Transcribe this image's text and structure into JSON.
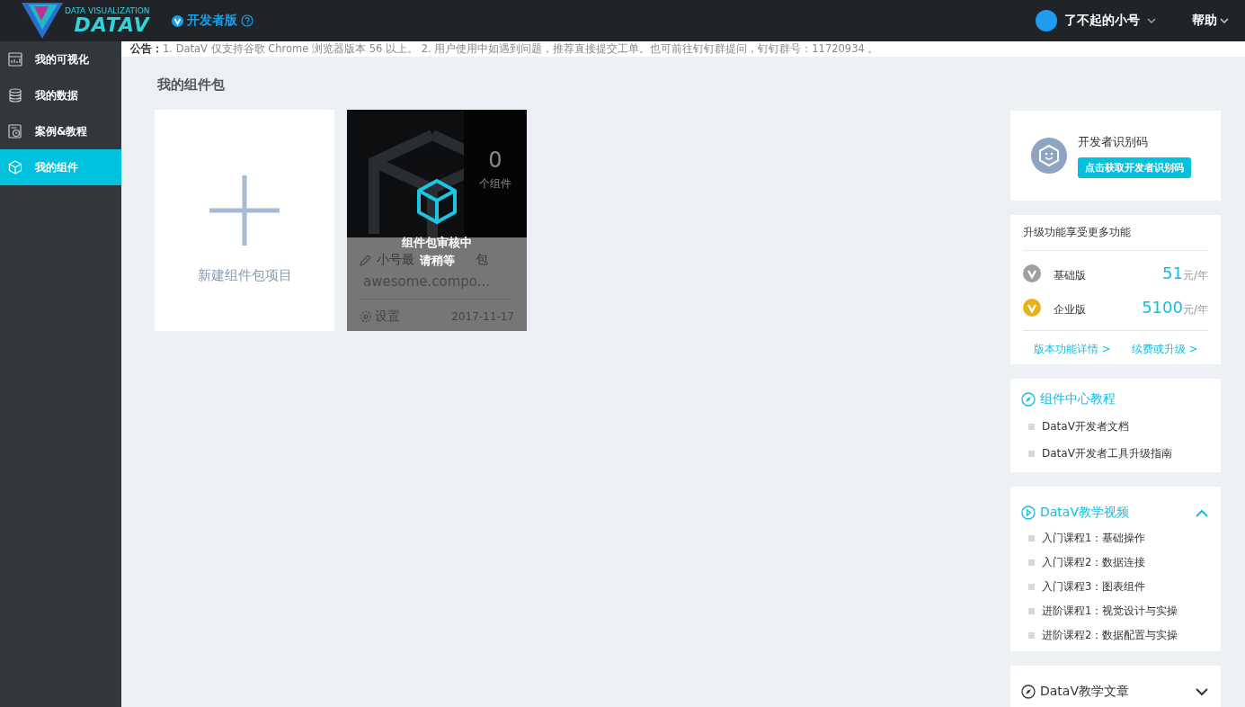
{
  "header": {
    "logo_caption": "DATA VISUALIZATION",
    "logo_text": "DATAV",
    "edition": "开发者版",
    "user": "了不起的小号",
    "help": "帮助"
  },
  "sidebar": {
    "items": [
      {
        "label": "我的可视化",
        "selected": false
      },
      {
        "label": "我的数据",
        "selected": false
      },
      {
        "label": "案例&教程",
        "selected": false
      },
      {
        "label": "我的组件",
        "selected": true
      }
    ]
  },
  "notice": {
    "label": "公告：",
    "text": "1. DataV 仅支持谷歌 Chrome 浏览器版本 56 以上。 2. 用户使用中如遇到问题，推荐直接提交工单。也可前往钉钉群提问，钉钉群号：11720934 。"
  },
  "page_title": "我的组件包",
  "new_card": {
    "label": "新建组件包项目"
  },
  "packages": [
    {
      "count": "0",
      "count_label": "个组件",
      "title_start": "小号最",
      "title_end": "包",
      "package_name": "awesome.compo...",
      "settings": "设置",
      "date": "2017-11-17",
      "reviewing": true,
      "review_line1": "组件包审核中",
      "review_line2": "请稍等"
    }
  ],
  "developer_code": {
    "title": "开发者识别码",
    "button": "点击获取开发者识别码"
  },
  "upgrade": {
    "title": "升级功能享受更多功能",
    "plans": [
      {
        "name": "基础版",
        "price": "51",
        "unit": "元/年",
        "color": "#a0a0a0"
      },
      {
        "name": "企业版",
        "price": "5100",
        "unit": "元/年",
        "color": "#e6b220"
      }
    ],
    "links": [
      "版本功能详情 >",
      "续费或升级 >"
    ]
  },
  "tutorials": {
    "title": "组件中心教程",
    "items": [
      "DataV开发者文档",
      "DataV开发者工具升级指南"
    ]
  },
  "sections": [
    {
      "title": "DataV教学视频",
      "expanded": true,
      "items": [
        "入门课程1：基础操作",
        "入门课程2：数据连接",
        "入门课程3：图表组件",
        "进阶课程1：视觉设计与实操",
        "进阶课程2：数据配置与实操"
      ]
    },
    {
      "title": "DataV教学文章",
      "expanded": false
    }
  ]
}
